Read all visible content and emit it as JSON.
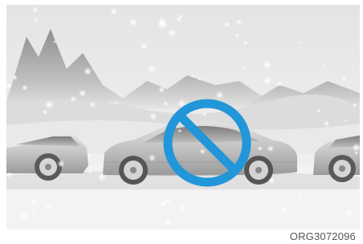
{
  "illustration": {
    "description_icon": "prohibition-icon",
    "prohibition_color": "#2196d9",
    "scene_palette": {
      "sky": "#e6e6e6",
      "mountain": "#a8a8a8",
      "snow": "#f7f7f7",
      "car_body": "#c8c8c8"
    }
  },
  "caption": {
    "code": "ORG3072096"
  }
}
